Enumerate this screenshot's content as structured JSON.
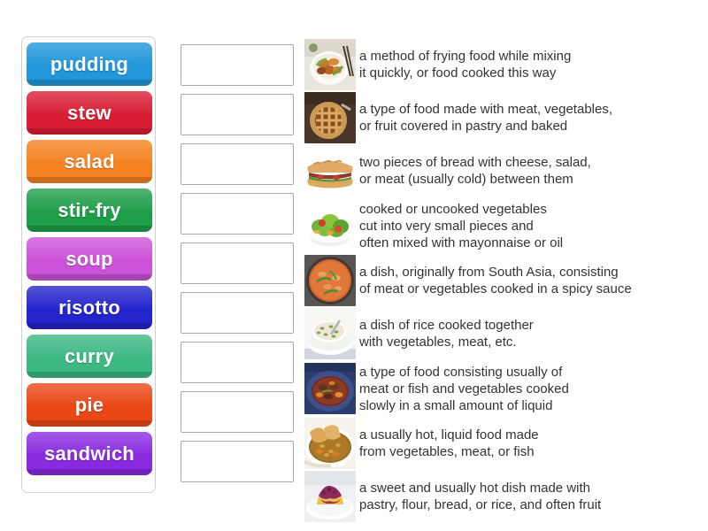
{
  "activity": {
    "type": "match-up",
    "topic": "Food and cooking vocabulary"
  },
  "tiles": [
    {
      "label": "pudding",
      "color": "#2196d8"
    },
    {
      "label": "stew",
      "color": "#d81e34"
    },
    {
      "label": "salad",
      "color": "#f58220"
    },
    {
      "label": "stir-fry",
      "color": "#1f9e4a"
    },
    {
      "label": "soup",
      "color": "#cc52d8"
    },
    {
      "label": "risotto",
      "color": "#2424cc"
    },
    {
      "label": "curry",
      "color": "#3cb882"
    },
    {
      "label": "pie",
      "color": "#ea4716"
    },
    {
      "label": "sandwich",
      "color": "#8a2be2"
    }
  ],
  "answer_boxes": [
    {
      "value": "",
      "placeholder": ""
    },
    {
      "value": "",
      "placeholder": ""
    },
    {
      "value": "",
      "placeholder": ""
    },
    {
      "value": "",
      "placeholder": ""
    },
    {
      "value": "",
      "placeholder": ""
    },
    {
      "value": "",
      "placeholder": ""
    },
    {
      "value": "",
      "placeholder": ""
    },
    {
      "value": "",
      "placeholder": ""
    },
    {
      "value": "",
      "placeholder": ""
    }
  ],
  "definitions": [
    {
      "text": "a method of frying food while mixing\nit quickly, or food cooked this way",
      "image": "stir-fry-bowl-thumbnail"
    },
    {
      "text": "a type of food made with meat, vegetables,\nor fruit covered in pastry and baked",
      "image": "lattice-pie-thumbnail"
    },
    {
      "text": "two pieces of bread with cheese, salad,\nor meat (usually cold) between them",
      "image": "submarine-sandwich-thumbnail"
    },
    {
      "text": "cooked or uncooked vegetables\ncut into very small pieces and\noften mixed with mayonnaise or oil",
      "image": "green-salad-bowl-thumbnail"
    },
    {
      "text": "a dish, originally from South Asia, consisting\nof meat or vegetables cooked in a spicy sauce",
      "image": "curry-pot-thumbnail"
    },
    {
      "text": "a dish of rice cooked together\nwith vegetables, meat, etc.",
      "image": "risotto-bowl-thumbnail"
    },
    {
      "text": "a type of food consisting usually of\nmeat or fish and vegetables cooked\nslowly in a small amount of liquid",
      "image": "beef-stew-plate-thumbnail"
    },
    {
      "text": "a usually hot, liquid food made\nfrom vegetables, meat, or fish",
      "image": "vegetable-soup-bread-thumbnail"
    },
    {
      "text": "a sweet and usually hot dish made with\npastry, flour, bread, or rice, and often fruit",
      "image": "sponge-pudding-plate-thumbnail"
    }
  ],
  "colors": {
    "page_background": "#ffffff",
    "text": "#333333",
    "panel_border": "#cfcfcf",
    "answer_box_border": "#a9a9a9"
  }
}
